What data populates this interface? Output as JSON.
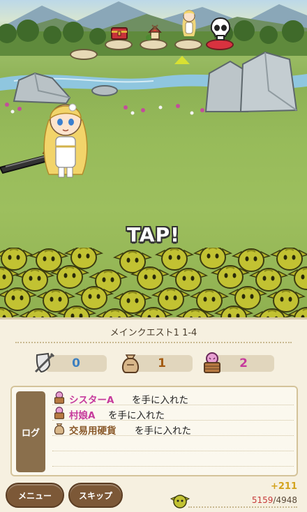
{
  "stage": {
    "nodes": [
      "treasure-chest-icon",
      "village-icon",
      "hero-icon",
      "skull-icon"
    ]
  },
  "battle": {
    "tap_text": "TAP!"
  },
  "panel": {
    "quest_title": "メインクエスト1 1-4",
    "counters": [
      {
        "icon": "shield-sword-icon",
        "value": "0",
        "color": "#3d7fc0"
      },
      {
        "icon": "money-bag-icon",
        "value": "1",
        "color": "#a35b12"
      },
      {
        "icon": "captive-basket-icon",
        "value": "2",
        "color": "#c63a9c"
      }
    ],
    "log_label": "ログ",
    "log": [
      {
        "icon": "captive-basket-icon",
        "name": "シスターA",
        "text": "を手に入れた",
        "name_color": "#c63a9c"
      },
      {
        "icon": "captive-basket-icon",
        "name": "村娘A",
        "text": "を手に入れた",
        "name_color": "#c63a9c"
      },
      {
        "icon": "money-bag-icon",
        "name": "交易用硬貨",
        "text": "を手に入れた",
        "name_color": "#8a5a2b"
      }
    ],
    "menu_button": "メニュー",
    "skip_button": "スキップ",
    "gain": "+211",
    "progress_current": "5159",
    "progress_total": "/4948"
  }
}
